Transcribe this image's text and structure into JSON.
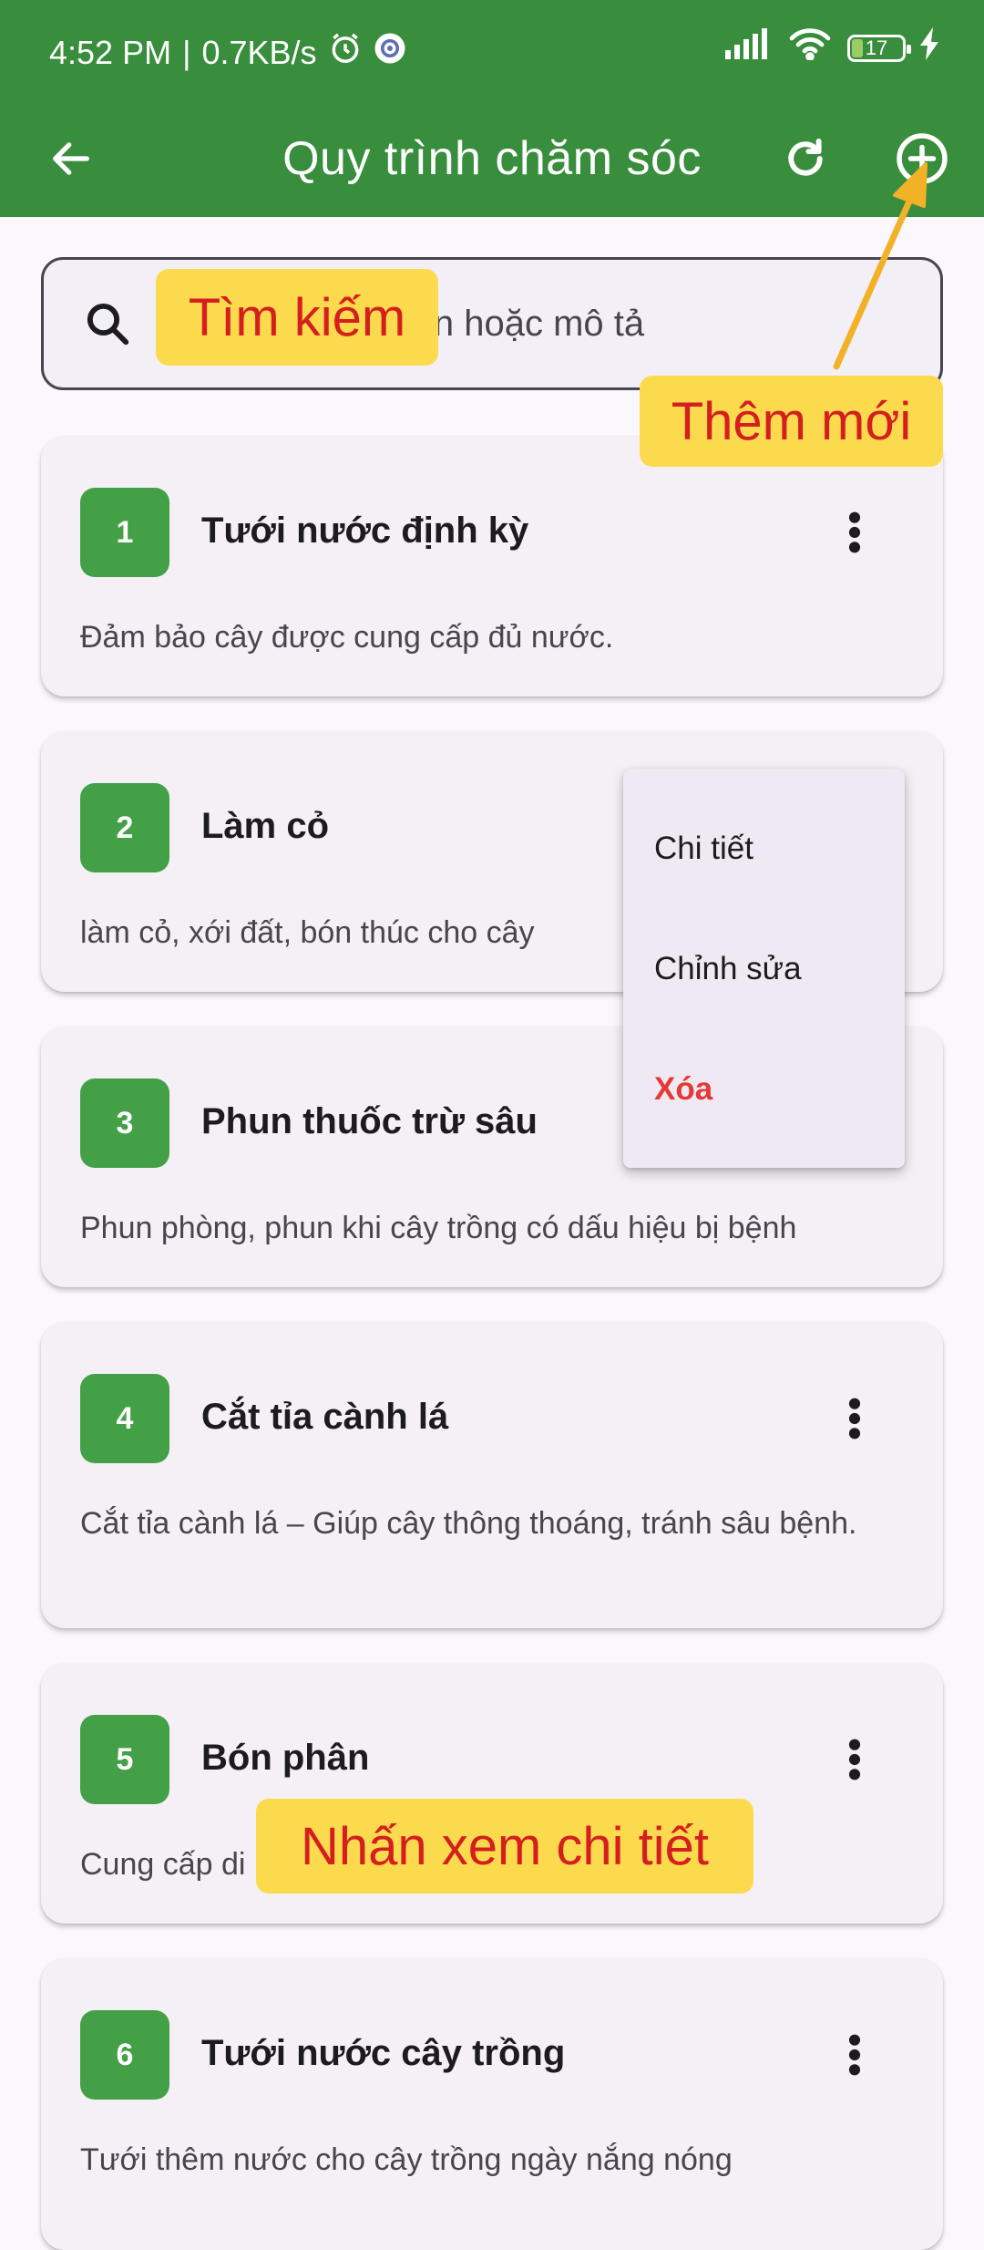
{
  "status_bar": {
    "time": "4:52 PM",
    "separator": "|",
    "speed": "0.7KB/s",
    "battery": "17",
    "icons": [
      "alarm-icon",
      "settings-gear-icon",
      "signal-icon",
      "wifi-icon",
      "battery-icon",
      "charging-icon"
    ]
  },
  "appbar": {
    "title": "Quy trình chăm sóc",
    "color": "#388e3c",
    "icons": [
      "back-arrow-icon",
      "refresh-icon",
      "add-circle-icon"
    ]
  },
  "search": {
    "placeholder": "Tìm kiếm theo tên hoặc mô tả",
    "visible_text": "tên hoặc mô tả"
  },
  "cards": [
    {
      "number": "1",
      "title": "Tưới nước định kỳ",
      "description": "Đảm bảo cây được cung cấp đủ nước."
    },
    {
      "number": "2",
      "title": "Làm cỏ",
      "description": "làm cỏ, xới đất, bón thúc cho cây"
    },
    {
      "number": "3",
      "title": "Phun thuốc trừ sâu",
      "description": "Phun phòng, phun khi cây trồng có dấu hiệu bị bệnh"
    },
    {
      "number": "4",
      "title": "Cắt tỉa cành lá",
      "description": "Cắt tỉa cành lá – Giúp cây thông thoáng, tránh sâu bệnh."
    },
    {
      "number": "5",
      "title": "Bón phân",
      "description": "Cung cấp di"
    },
    {
      "number": "6",
      "title": "Tưới nước cây trồng",
      "description": "Tưới thêm nước cho cây trồng ngày nắng nóng"
    }
  ],
  "context_menu": {
    "items": [
      "Chi tiết",
      "Chỉnh sửa",
      "Xóa"
    ],
    "danger_color": "#e53935"
  },
  "annotations": {
    "search": "Tìm kiếm",
    "add_new": "Thêm mới",
    "view_detail": "Nhấn xem chi tiết",
    "callout_bg": "#fbdb4d",
    "callout_text": "#d51f1f",
    "arrow_color": "#f2b127"
  }
}
